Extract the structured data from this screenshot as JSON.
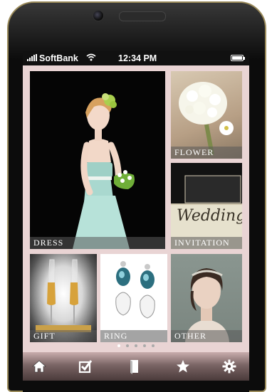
{
  "status_bar": {
    "carrier": "SoftBank",
    "time": "12:34 PM"
  },
  "tiles": {
    "dress": "DRESS",
    "flower": "FLOWER",
    "invitation": "INVITATION",
    "invitation_card_text": "Wedding",
    "gift": "GIFT",
    "ring": "RING",
    "other": "OTHER"
  },
  "page_indicator": {
    "count": 5,
    "current": 1
  },
  "tab_bar": {
    "items": [
      "home-icon",
      "checkbox-icon",
      "book-icon",
      "star-icon",
      "gear-icon"
    ]
  },
  "colors": {
    "screen_background": "#e9d4d4",
    "label_overlay": "#5a5a5a"
  }
}
